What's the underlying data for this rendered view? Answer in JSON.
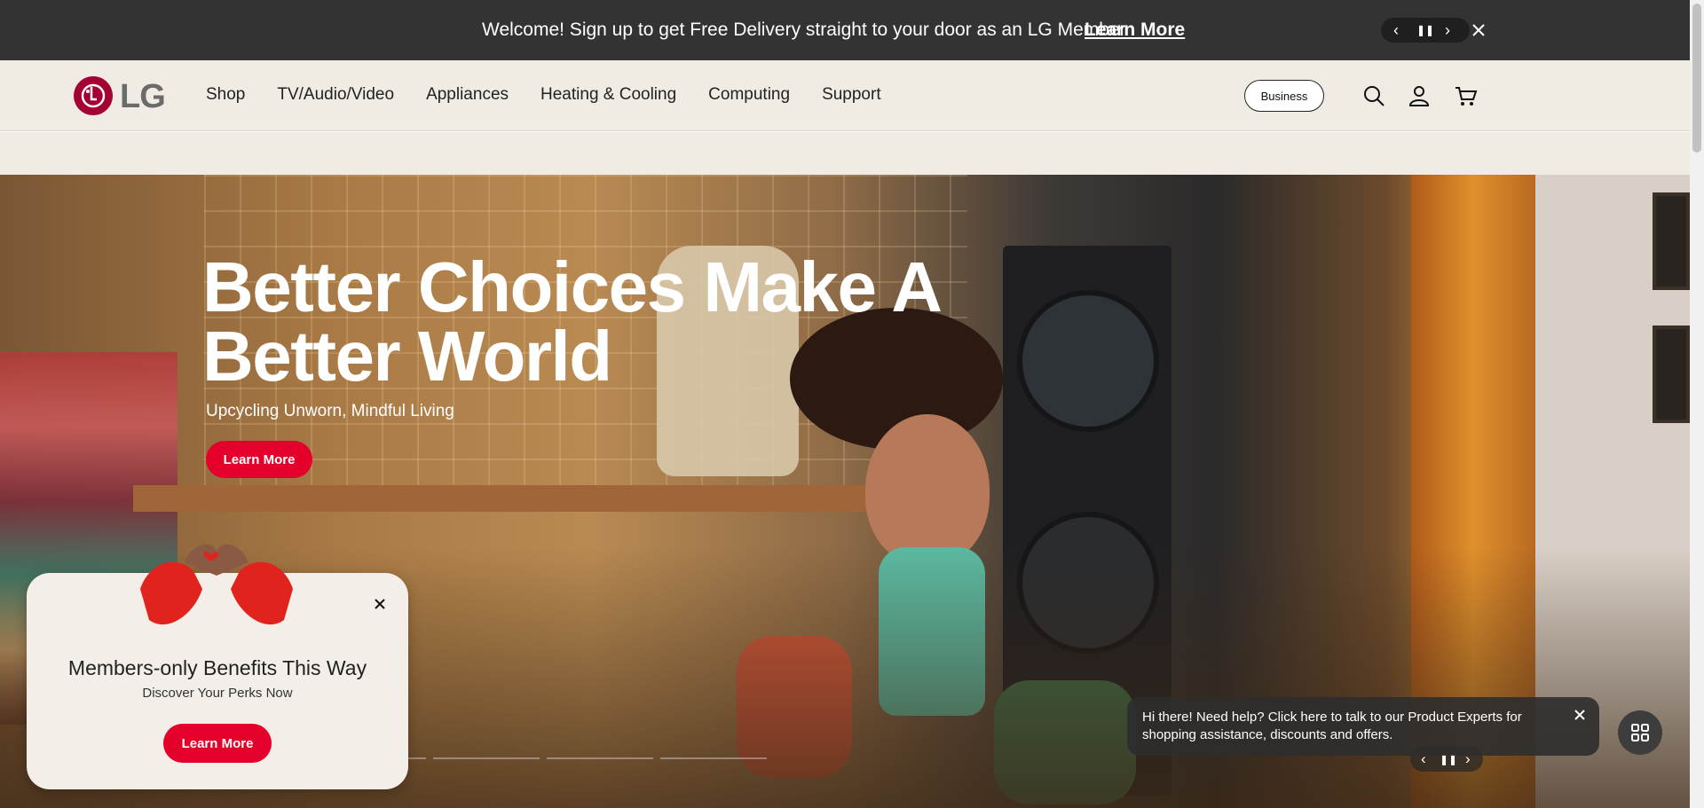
{
  "promo": {
    "message": "Welcome! Sign up to get Free Delivery straight to your door as an LG Member",
    "link": "Learn More",
    "prev": "‹",
    "pause": "❚❚",
    "next": "›",
    "close": "✕"
  },
  "header": {
    "logo_text": "LG",
    "nav": [
      "Shop",
      "TV/Audio/Video",
      "Appliances",
      "Heating & Cooling",
      "Computing",
      "Support"
    ],
    "business_label": "Business",
    "icons": [
      "search-icon",
      "account-icon",
      "cart-icon"
    ]
  },
  "hero": {
    "title": "Better Choices Make A Better World",
    "subtitle": "Upcycling Unworn, Mindful Living",
    "cta": "Learn More",
    "controls": {
      "prev": "‹",
      "pause": "❚❚",
      "next": "›"
    }
  },
  "members_popup": {
    "title": "Members-only Benefits This Way",
    "subtitle": "Discover Your Perks Now",
    "cta": "Learn More",
    "close": "✕"
  },
  "chat": {
    "message": "Hi there! Need help? Click here to talk to our Product Experts for shopping assistance, discounts and offers.",
    "close": "✕"
  },
  "colors": {
    "promo_bg": "#333333",
    "header_bg": "#f0ece4",
    "brand_red": "#e4002b",
    "logo_red": "#a50034"
  }
}
